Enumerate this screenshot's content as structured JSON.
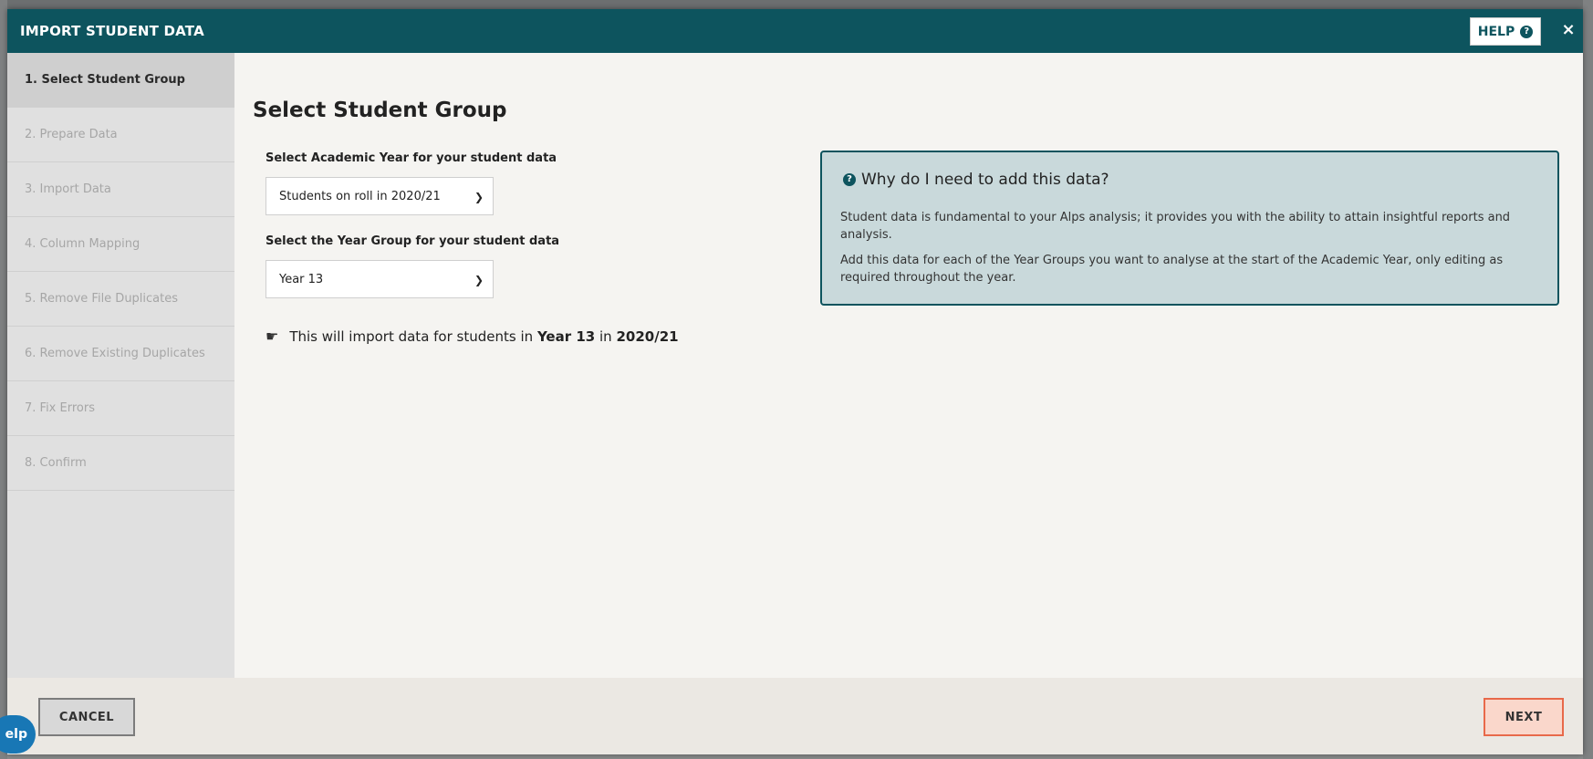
{
  "modal": {
    "title": "IMPORT STUDENT DATA",
    "help_label": "HELP",
    "close_symbol": "×"
  },
  "steps": [
    {
      "label": "1. Select Student Group",
      "active": true
    },
    {
      "label": "2. Prepare Data",
      "active": false
    },
    {
      "label": "3. Import Data",
      "active": false
    },
    {
      "label": "4. Column Mapping",
      "active": false
    },
    {
      "label": "5. Remove File Duplicates",
      "active": false
    },
    {
      "label": "6. Remove Existing Duplicates",
      "active": false
    },
    {
      "label": "7. Fix Errors",
      "active": false
    },
    {
      "label": "8. Confirm",
      "active": false
    }
  ],
  "content": {
    "title": "Select Student Group",
    "academic_year": {
      "label": "Select Academic Year for your student data",
      "value": "Students on roll in 2020/21"
    },
    "year_group": {
      "label": "Select the Year Group for your student data",
      "value": "Year 13"
    },
    "import_note": {
      "prefix": "This will import data for students in",
      "year_group": "Year 13",
      "middle": "in",
      "year": "2020/21"
    },
    "info": {
      "title": "Why do I need to add this data?",
      "p1": "Student data is fundamental to your Alps analysis; it provides you with the ability to attain insightful reports and analysis.",
      "p2": "Add this data for each of the Year Groups you want to analyse at the start of the Academic Year, only editing as required throughout the year."
    }
  },
  "footer": {
    "cancel_label": "CANCEL",
    "next_label": "NEXT"
  },
  "floating_help": {
    "label": "elp"
  },
  "colors": {
    "header": "#0d545e",
    "info_box_bg": "#c9d9db",
    "next_border": "#e8694a",
    "next_bg": "#fad7cb",
    "help_tab": "#1877b5"
  }
}
